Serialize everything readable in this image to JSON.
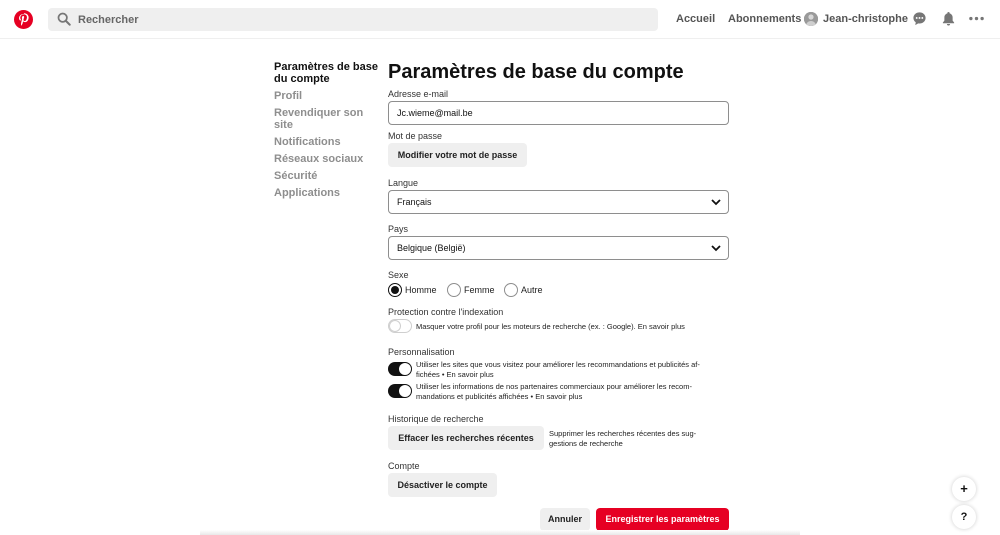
{
  "header": {
    "search_placeholder": "Rechercher",
    "nav_home": "Accueil",
    "nav_subscriptions": "Abonnements",
    "user_name": "Jean-christophe",
    "brand_color": "#e60023"
  },
  "sidebar": {
    "items": [
      {
        "label": "Paramètres de base du compte",
        "active": true
      },
      {
        "label": "Profil"
      },
      {
        "label": "Revendiquer son site"
      },
      {
        "label": "Notifications"
      },
      {
        "label": "Réseaux sociaux"
      },
      {
        "label": "Sécurité"
      },
      {
        "label": "Applications"
      }
    ]
  },
  "main": {
    "title": "Paramètres de base du compte",
    "email": {
      "label": "Adresse e-mail",
      "value": "Jc.wieme@mail.be"
    },
    "password": {
      "label": "Mot de passe",
      "button": "Modifier votre mot de passe"
    },
    "language": {
      "label": "Langue",
      "value": "Français"
    },
    "country": {
      "label": "Pays",
      "value": "Belgique (België)"
    },
    "gender": {
      "label": "Sexe",
      "options": [
        "Homme",
        "Femme",
        "Autre"
      ],
      "selected": "Homme"
    },
    "indexing": {
      "label": "Protection contre l'indexation",
      "description": "Masquer votre profil pour les moteurs de recherche (ex. : Google). En savoir plus",
      "enabled": false
    },
    "personalisation": {
      "label": "Personnalisation",
      "items": [
        {
          "line1": "Utiliser les sites que vous visitez pour améliorer les recommandations et publicités af-",
          "line2": "fichées • En savoir plus",
          "enabled": true
        },
        {
          "line1": "Utiliser les informations de nos partenaires commerciaux pour améliorer les recom-",
          "line2": "mandations et publicités affichées • En savoir plus",
          "enabled": true
        }
      ]
    },
    "history": {
      "label": "Historique de recherche",
      "button": "Effacer les recherches récentes",
      "desc_line1": "Supprimer les recherches récentes des sug-",
      "desc_line2": "gestions de recherche"
    },
    "account": {
      "label": "Compte",
      "button": "Désactiver le compte"
    },
    "actions": {
      "cancel": "Annuler",
      "save": "Enregistrer les paramètres"
    }
  },
  "floating": {
    "add": "+",
    "help": "?"
  }
}
